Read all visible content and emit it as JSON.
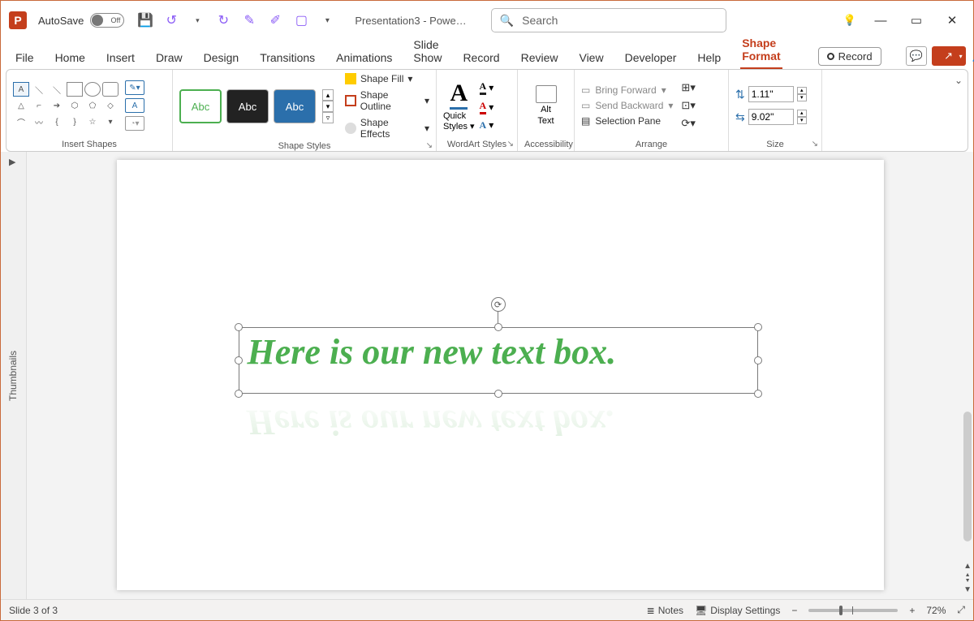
{
  "titlebar": {
    "app_letter": "P",
    "autosave_label": "AutoSave",
    "autosave_state": "Off",
    "doc_title": "Presentation3  -  Powe…",
    "search_placeholder": "Search"
  },
  "tabs": {
    "items": [
      "File",
      "Home",
      "Insert",
      "Draw",
      "Design",
      "Transitions",
      "Animations",
      "Slide Show",
      "Record",
      "Review",
      "View",
      "Developer",
      "Help",
      "Shape Format"
    ],
    "active": "Shape Format",
    "record_button": "Record"
  },
  "ribbon": {
    "insert_shapes": {
      "label": "Insert Shapes"
    },
    "shape_styles": {
      "label": "Shape Styles",
      "swatch_text": "Abc",
      "fill": "Shape Fill",
      "outline": "Shape Outline",
      "effects": "Shape Effects"
    },
    "wordart": {
      "label": "WordArt Styles",
      "quick": "Quick",
      "styles": "Styles"
    },
    "accessibility": {
      "label": "Accessibility",
      "alt1": "Alt",
      "alt2": "Text"
    },
    "arrange": {
      "label": "Arrange",
      "bring_forward": "Bring Forward",
      "send_backward": "Send Backward",
      "selection_pane": "Selection Pane"
    },
    "size": {
      "label": "Size",
      "height": "1.11\"",
      "width": "9.02\""
    }
  },
  "thumbnails_label": "Thumbnails",
  "slide": {
    "textbox_content": "Here is our new text box."
  },
  "statusbar": {
    "slide_info": "Slide 3 of 3",
    "notes": "Notes",
    "display_settings": "Display Settings",
    "zoom_pct": "72%"
  }
}
